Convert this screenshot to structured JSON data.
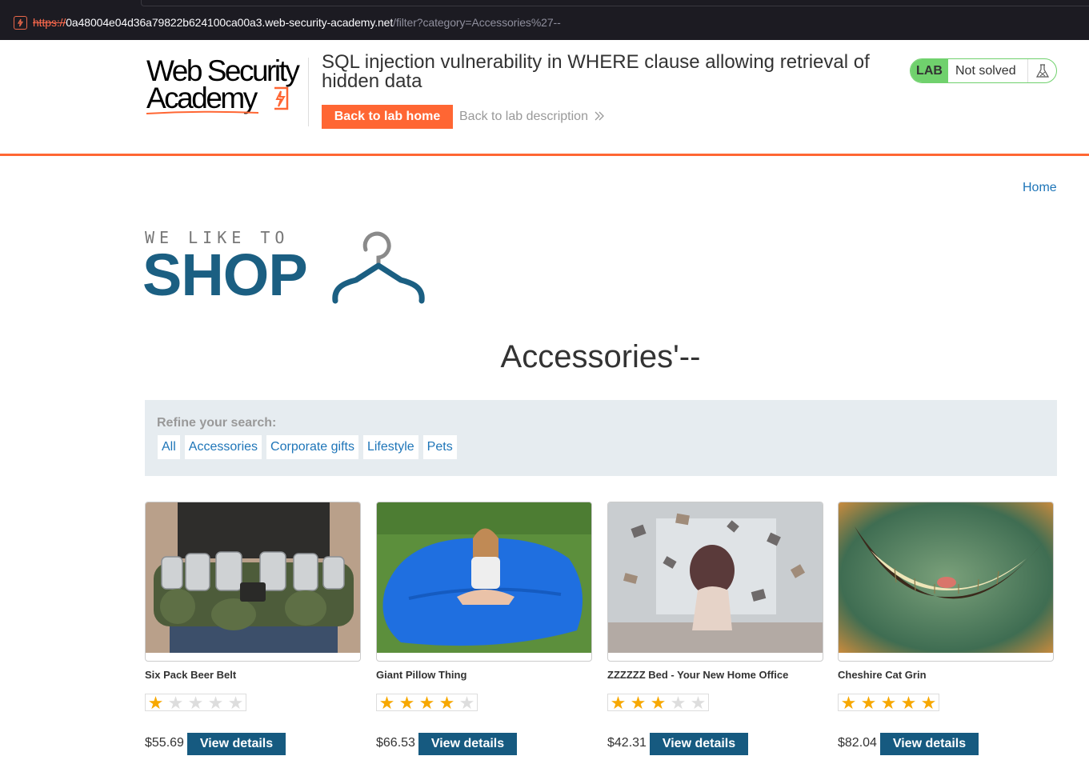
{
  "browser": {
    "url_protocol": "https://",
    "url_host": "0a48004e04d36a79822b624100ca00a3.web-security-academy.net",
    "url_path": "/filter?category=Accessories%27--"
  },
  "lab_header": {
    "logo_line1": "Web Security",
    "logo_line2": "Academy",
    "title": "SQL injection vulnerability in WHERE clause allowing retrieval of hidden data",
    "back_home_label": "Back to lab home",
    "back_description_label": "Back to lab description",
    "status_badge": "LAB",
    "status_text": "Not solved",
    "accent_color": "#ff6633",
    "status_color": "#70d16d"
  },
  "shop": {
    "home_link": "Home",
    "logo_small": "WE LIKE TO",
    "logo_big": "SHOP",
    "category_heading": "Accessories'--",
    "refine_label": "Refine your search:",
    "filters": [
      "All",
      "Accessories",
      "Corporate gifts",
      "Lifestyle",
      "Pets"
    ],
    "products": [
      {
        "name": "Six Pack Beer Belt",
        "rating": 1,
        "price": "$55.69",
        "button": "View details",
        "image_icon": "beer-belt-image"
      },
      {
        "name": "Giant Pillow Thing",
        "rating": 4,
        "price": "$66.53",
        "button": "View details",
        "image_icon": "giant-pillow-image"
      },
      {
        "name": "ZZZZZZ Bed - Your New Home Office",
        "rating": 3,
        "price": "$42.31",
        "button": "View details",
        "image_icon": "bed-office-image"
      },
      {
        "name": "Cheshire Cat Grin",
        "rating": 5,
        "price": "$82.04",
        "button": "View details",
        "image_icon": "cat-grin-image"
      }
    ],
    "brand_color": "#165a80"
  }
}
